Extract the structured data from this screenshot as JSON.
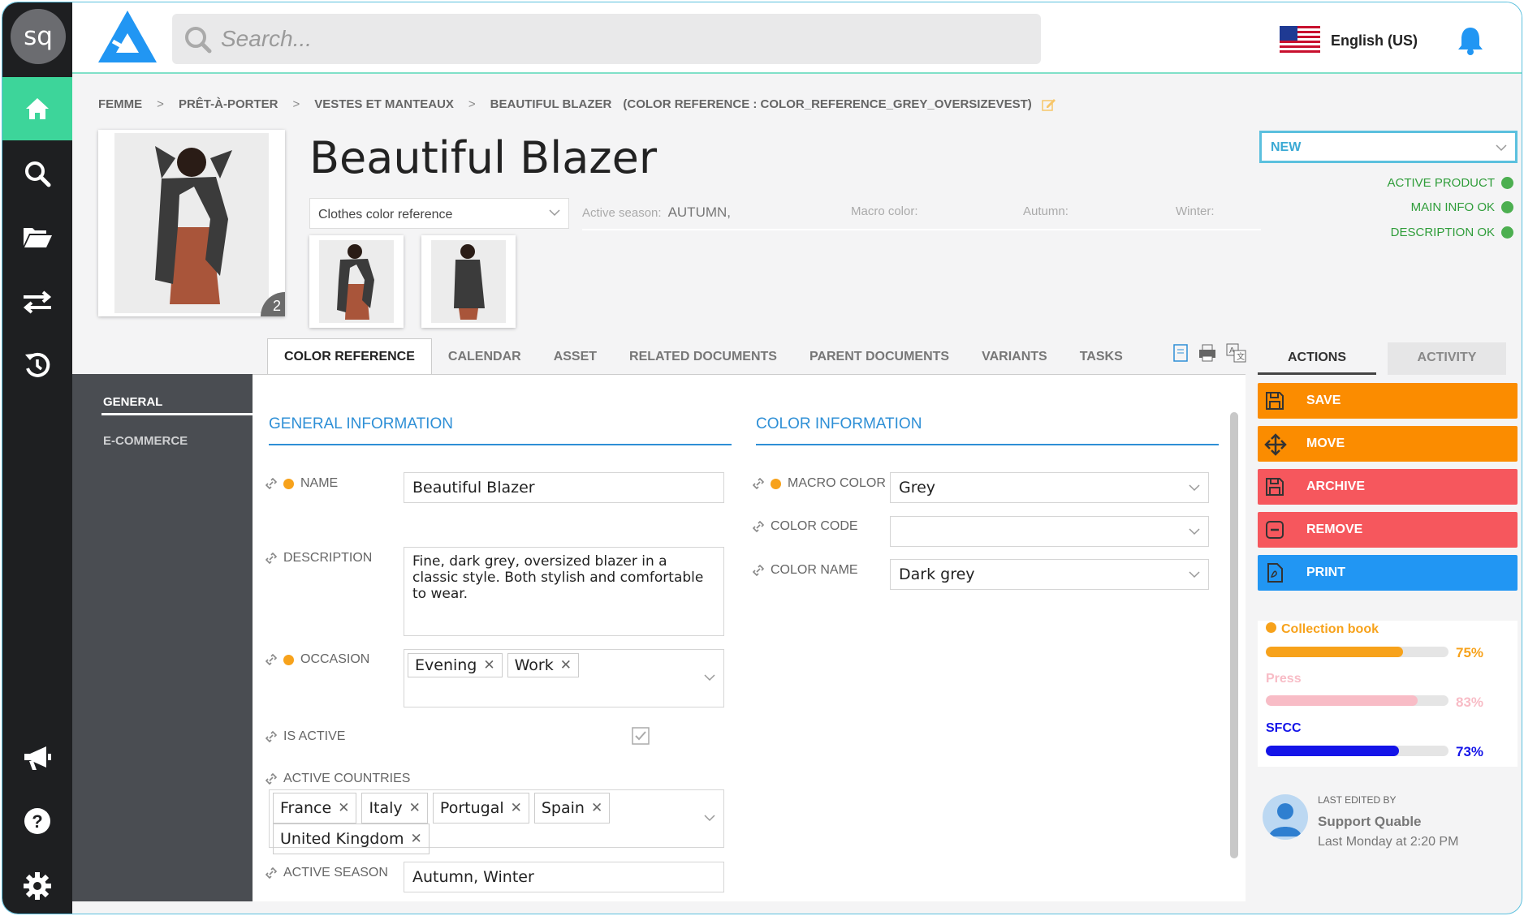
{
  "user": {
    "initials": "sq"
  },
  "search": {
    "placeholder": "Search..."
  },
  "header": {
    "language": "English (US)"
  },
  "breadcrumb": {
    "items": [
      "FEMME",
      "PRÊT-À-PORTER",
      "VESTES ET MANTEAUX",
      "BEAUTIFUL BLAZER"
    ],
    "separator": ">",
    "reference": "(COLOR REFERENCE : COLOR_REFERENCE_GREY_OVERSIZEVEST)"
  },
  "product": {
    "title": "Beautiful Blazer",
    "image_count": "2",
    "reference_select": "Clothes color reference"
  },
  "meta": {
    "active_season_label": "Active season:",
    "active_season_value": "AUTUMN,",
    "macro_color_label": "Macro color:",
    "autumn_label": "Autumn:",
    "winter_label": "Winter:"
  },
  "status": {
    "selected": "NEW",
    "checks": [
      "ACTIVE PRODUCT",
      "MAIN INFO OK",
      "DESCRIPTION OK"
    ],
    "check_color": "#4caf50"
  },
  "tabs": [
    "COLOR REFERENCE",
    "CALENDAR",
    "ASSET",
    "RELATED DOCUMENTS",
    "PARENT DOCUMENTS",
    "VARIANTS",
    "TASKS"
  ],
  "subnav": [
    "GENERAL",
    "E-COMMERCE"
  ],
  "general": {
    "title": "GENERAL INFORMATION",
    "name_label": "NAME",
    "name_value": "Beautiful Blazer",
    "description_label": "DESCRIPTION",
    "description_value": "Fine, dark grey, oversized blazer in a classic style. Both stylish and comfortable to wear.",
    "occasion_label": "OCCASION",
    "occasions": [
      "Evening",
      "Work"
    ],
    "is_active_label": "IS ACTIVE",
    "is_active": true,
    "countries_label": "ACTIVE COUNTRIES",
    "countries": [
      "France",
      "Italy",
      "Portugal",
      "Spain",
      "United Kingdom"
    ],
    "season_label": "ACTIVE SEASON",
    "season_value": "Autumn, Winter"
  },
  "color": {
    "title": "COLOR INFORMATION",
    "macro_label": "MACRO COLOR",
    "macro_value": "Grey",
    "code_label": "COLOR CODE",
    "code_value": "",
    "name_label": "COLOR NAME",
    "name_value": "Dark grey"
  },
  "right_tabs": [
    "ACTIONS",
    "ACTIVITY"
  ],
  "actions": [
    {
      "label": "SAVE",
      "color": "#fb8c00"
    },
    {
      "label": "MOVE",
      "color": "#fb8c00"
    },
    {
      "label": "ARCHIVE",
      "color": "#f6575d"
    },
    {
      "label": "REMOVE",
      "color": "#f6575d"
    },
    {
      "label": "PRINT",
      "color": "#2196f3"
    }
  ],
  "progress": [
    {
      "name": "Collection book",
      "percent_label": "75%",
      "value": 0.75,
      "color": "#f7a21b"
    },
    {
      "name": "Press",
      "percent_label": "83%",
      "value": 0.83,
      "color": "#f8bcc6"
    },
    {
      "name": "SFCC",
      "percent_label": "73%",
      "value": 0.73,
      "color": "#1414e8"
    }
  ],
  "last_edit": {
    "label": "LAST EDITED BY",
    "user": "Support Quable",
    "time": "Last Monday at 2:20 PM"
  }
}
